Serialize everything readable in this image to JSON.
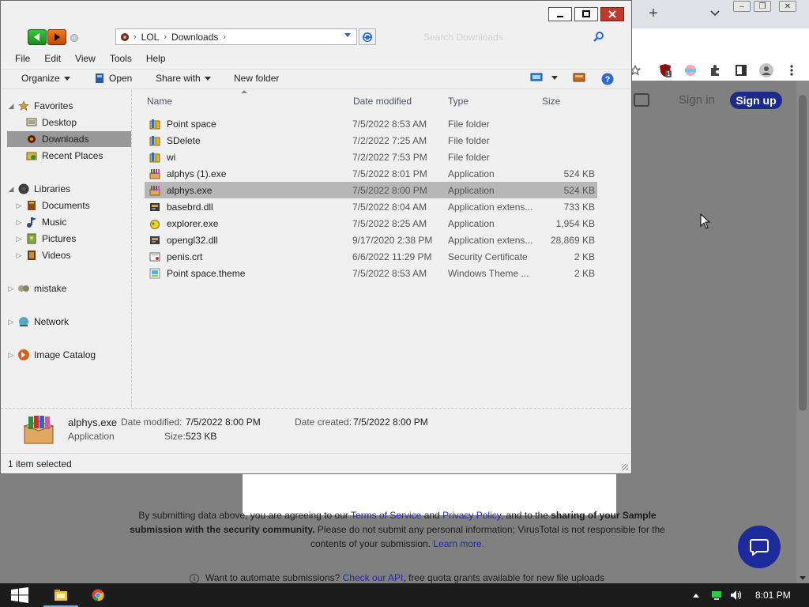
{
  "explorer": {
    "address": {
      "crumbs": [
        "LOL",
        "Downloads"
      ]
    },
    "search": {
      "placeholder": "Search Downloads"
    },
    "menu": [
      "File",
      "Edit",
      "View",
      "Tools",
      "Help"
    ],
    "commands": {
      "organize": "Organize",
      "open": "Open",
      "share_with": "Share with",
      "new_folder": "New folder"
    },
    "nav": {
      "favorites": "Favorites",
      "desktop": "Desktop",
      "downloads": "Downloads",
      "recent_places": "Recent Places",
      "libraries": "Libraries",
      "documents": "Documents",
      "music": "Music",
      "pictures": "Pictures",
      "videos": "Videos",
      "mistake": "mistake",
      "network": "Network",
      "image_catalog": "Image Catalog"
    },
    "columns": {
      "name": "Name",
      "date": "Date modified",
      "type": "Type",
      "size": "Size"
    },
    "files": [
      {
        "name": "Point space",
        "date": "7/5/2022 8:53 AM",
        "type": "File folder",
        "size": "",
        "icon": "folder-icon"
      },
      {
        "name": "SDelete",
        "date": "7/2/2022 7:25 AM",
        "type": "File folder",
        "size": "",
        "icon": "folder-icon"
      },
      {
        "name": "wi",
        "date": "7/2/2022 7:53 PM",
        "type": "File folder",
        "size": "",
        "icon": "folder-icon"
      },
      {
        "name": "alphys (1).exe",
        "date": "7/5/2022 8:01 PM",
        "type": "Application",
        "size": "524 KB",
        "icon": "app-box-icon"
      },
      {
        "name": "alphys.exe",
        "date": "7/5/2022 8:00 PM",
        "type": "Application",
        "size": "524 KB",
        "icon": "app-box-icon",
        "selected": true
      },
      {
        "name": "basebrd.dll",
        "date": "7/5/2022 8:04 AM",
        "type": "Application extens...",
        "size": "733 KB",
        "icon": "dll-icon"
      },
      {
        "name": "explorer.exe",
        "date": "7/5/2022 8:25 AM",
        "type": "Application",
        "size": "1,954 KB",
        "icon": "explorer-app-icon"
      },
      {
        "name": "opengl32.dll",
        "date": "9/17/2020 2:38 PM",
        "type": "Application extens...",
        "size": "28,869 KB",
        "icon": "dll-icon"
      },
      {
        "name": "penis.crt",
        "date": "6/6/2022 11:29 PM",
        "type": "Security Certificate",
        "size": "2 KB",
        "icon": "certificate-icon"
      },
      {
        "name": "Point space.theme",
        "date": "7/5/2022 8:53 AM",
        "type": "Windows Theme ...",
        "size": "2 KB",
        "icon": "theme-icon"
      }
    ],
    "details": {
      "name": "alphys.exe",
      "kind": "Application",
      "date_modified_label": "Date modified:",
      "date_modified": "7/5/2022 8:00 PM",
      "date_created_label": "Date created:",
      "date_created": "7/5/2022 8:00 PM",
      "size_label": "Size:",
      "size": "523 KB"
    },
    "status": "1 item selected"
  },
  "browser": {
    "sign_in": "Sign in",
    "sign_up": "Sign up",
    "extension_badge": "1",
    "disclaimer": {
      "part1": "By submitting data above, you are agreeing to our ",
      "terms": "Terms of Service",
      "and": " and ",
      "privacy": "Privacy Policy",
      "part2": ", and to the ",
      "bold": "sharing of your Sample submission with the security community.",
      "part3": " Please do not submit any personal information; VirusTotal is not responsible for the contents of your submission. ",
      "learn_more": "Learn more."
    },
    "automate": {
      "text": "Want to automate submissions? ",
      "api_link": "Check our API",
      "rest": ", free quota grants available for new file uploads"
    }
  },
  "taskbar": {
    "clock": "8:01 PM"
  },
  "colors": {
    "accent_blue": "#1c2a8c",
    "selection_gray": "#b7b7b7",
    "close_red": "#c0392b"
  }
}
